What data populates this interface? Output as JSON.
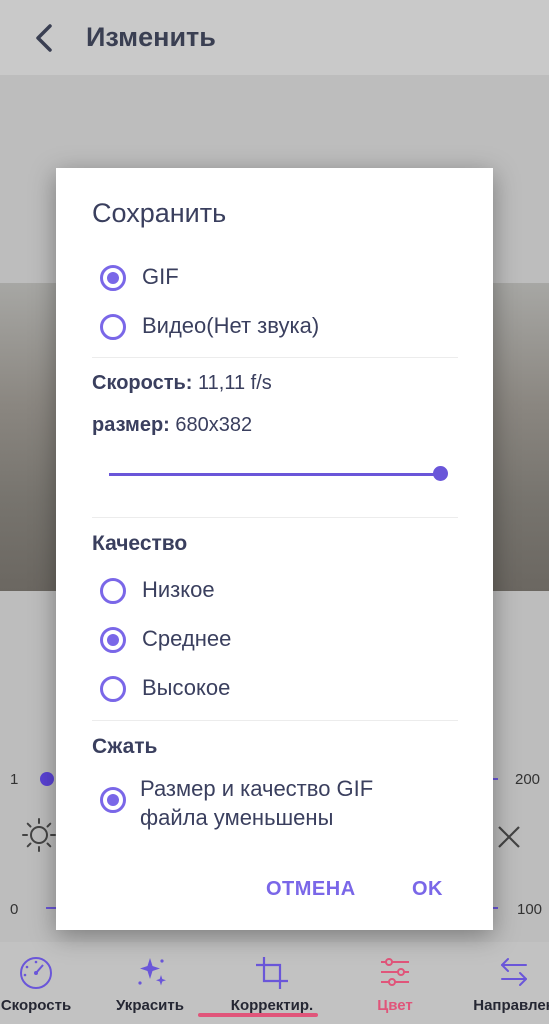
{
  "appbar": {
    "title": "Изменить"
  },
  "dialog": {
    "title": "Сохранить",
    "format_options": [
      {
        "label": "GIF",
        "selected": true
      },
      {
        "label": "Видео(Нет звука)",
        "selected": false
      }
    ],
    "speed_label": "Скорость:",
    "speed_value": "11,11 f/s",
    "size_label": "размер:",
    "size_value": "680x382",
    "size_slider_position": 1.0,
    "quality_label": "Качество",
    "quality_options": [
      {
        "label": "Низкое",
        "selected": false
      },
      {
        "label": "Среднее",
        "selected": true
      },
      {
        "label": "Высокое",
        "selected": false
      }
    ],
    "compress_label": "Сжать",
    "compress_option": {
      "label_line1": "Размер и качество GIF",
      "label_line2": "файла уменьшены",
      "selected": true
    },
    "cancel_label": "ОТМЕНА",
    "ok_label": "OK"
  },
  "background_controls": {
    "left_top": "1",
    "right_top": "200",
    "left_bottom": "0",
    "right_bottom": "100"
  },
  "bottom_nav": {
    "items": [
      {
        "label": "Скорость",
        "icon": "speedometer-icon"
      },
      {
        "label": "Украсить",
        "icon": "sparkles-icon"
      },
      {
        "label": "Корректир.",
        "icon": "crop-icon"
      },
      {
        "label": "Цвет",
        "icon": "sliders-icon",
        "active": true
      },
      {
        "label": "Направлен",
        "icon": "swap-arrows-icon"
      }
    ]
  },
  "colors": {
    "accent": "#7a67e8",
    "active_nav": "#e0557a",
    "text": "#3a3f5e"
  }
}
